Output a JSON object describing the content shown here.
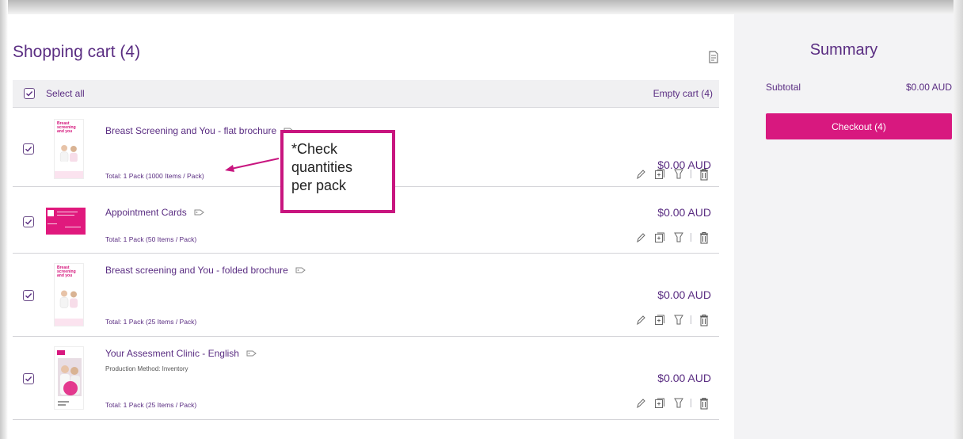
{
  "cart": {
    "title": "Shopping cart (4)",
    "select_all": "Select all",
    "empty_cart": "Empty cart  (4)",
    "items": [
      {
        "title": "Breast Screening and You - flat brochure",
        "total": "Total: 1 Pack (1000 Items / Pack)",
        "price": "$0.00 AUD",
        "checked": true,
        "thumb_text": "Breast\nscreening\nand you"
      },
      {
        "title": "Appointment Cards",
        "total": "Total: 1 Pack (50 Items / Pack)",
        "price": "$0.00 AUD",
        "checked": true
      },
      {
        "title": "Breast screening and You - folded brochure",
        "total": "Total: 1 Pack (25 Items / Pack)",
        "price": "$0.00 AUD",
        "checked": true,
        "thumb_text": "Breast\nscreening\nand you"
      },
      {
        "title": "Your Assesment Clinic - English",
        "production": "Production Method: Inventory",
        "total": "Total: 1 Pack (25 Items / Pack)",
        "price": "$0.00 AUD",
        "checked": true
      }
    ]
  },
  "callout": {
    "text": "*Check\nquantities\nper pack"
  },
  "summary": {
    "title": "Summary",
    "subtotal_label": "Subtotal",
    "subtotal_value": "$0.00 AUD",
    "checkout_label": "Checkout (4)"
  },
  "icons": [
    "export-icon",
    "checkbox-icon",
    "tag-icon",
    "edit-icon",
    "duplicate-icon",
    "save-for-later-icon",
    "delete-icon",
    "arrow-icon"
  ],
  "colors": {
    "brand_purple": "#5a2d82",
    "accent_pink": "#d8187f",
    "summary_bg": "#f3f3f5"
  }
}
